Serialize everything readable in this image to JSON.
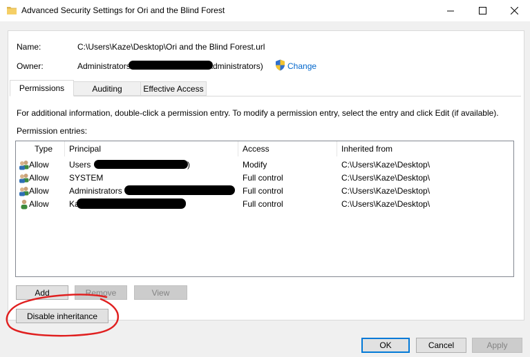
{
  "window": {
    "title": "Advanced Security Settings for Ori and the Blind Forest"
  },
  "info": {
    "name_label": "Name:",
    "name_value": "C:\\Users\\Kaze\\Desktop\\Ori and the Blind Forest.url",
    "owner_label": "Owner:",
    "owner_prefix": "Administrators",
    "owner_suffix": "Administrators)",
    "change_link": "Change"
  },
  "tabs": [
    {
      "label": "Permissions",
      "active": true
    },
    {
      "label": "Auditing",
      "active": false
    },
    {
      "label": "Effective Access",
      "active": false
    }
  ],
  "panel": {
    "info_text": "For additional information, double-click a permission entry. To modify a permission entry, select the entry and click Edit (if available).",
    "entries_label": "Permission entries:"
  },
  "table": {
    "headers": [
      "Type",
      "Principal",
      "Access",
      "Inherited from"
    ],
    "rows": [
      {
        "type": "Allow",
        "principal": "Users",
        "principal_suffix": ")",
        "access": "Modify",
        "inherited": "C:\\Users\\Kaze\\Desktop\\"
      },
      {
        "type": "Allow",
        "principal": "SYSTEM",
        "principal_suffix": "",
        "access": "Full control",
        "inherited": "C:\\Users\\Kaze\\Desktop\\"
      },
      {
        "type": "Allow",
        "principal": "Administrators",
        "principal_suffix": "...",
        "access": "Full control",
        "inherited": "C:\\Users\\Kaze\\Desktop\\"
      },
      {
        "type": "Allow",
        "principal": "Ka",
        "principal_suffix": "",
        "access": "Full control",
        "inherited": "C:\\Users\\Kaze\\Desktop\\"
      }
    ]
  },
  "buttons": {
    "add": "Add",
    "remove": "Remove",
    "view": "View",
    "disable_inheritance": "Disable inheritance",
    "ok": "OK",
    "cancel": "Cancel",
    "apply": "Apply"
  },
  "icons": {
    "folder": "folder-icon",
    "shield": "uac-shield-icon",
    "group_user": "group-user-icon",
    "single_user": "single-user-icon"
  },
  "colors": {
    "link": "#0066cc",
    "annotation": "#e02020",
    "default_button_border": "#0078d7"
  }
}
